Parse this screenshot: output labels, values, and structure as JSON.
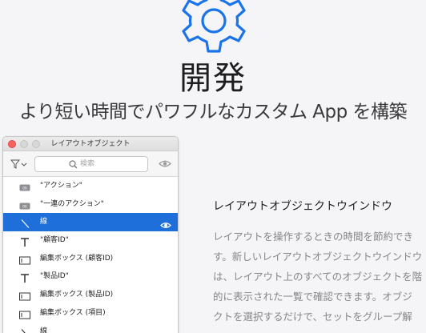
{
  "hero": {
    "icon": "gear-icon",
    "title": "開発",
    "subtitle": "より短い時間でパワフルなカスタム App を構築"
  },
  "colors": {
    "accent": "#1e6fd9",
    "gear": "#1a73e8",
    "close": "#fc605c"
  },
  "panel": {
    "title": "レイアウトオブジェクト",
    "search_placeholder": "検索",
    "rows": [
      {
        "icon": "button-icon",
        "label": "\"アクション\""
      },
      {
        "icon": "button-icon",
        "label": "\"一連のアクション\""
      },
      {
        "icon": "line-icon",
        "label": "線",
        "selected": true
      },
      {
        "icon": "text-icon",
        "label": "\"顧客ID\""
      },
      {
        "icon": "edit-box-icon",
        "label": "編集ボックス (顧客ID)"
      },
      {
        "icon": "text-icon",
        "label": "\"製品ID\""
      },
      {
        "icon": "edit-box-icon",
        "label": "編集ボックス (製品ID)"
      },
      {
        "icon": "edit-box-icon",
        "label": "編集ボックス (項目)"
      },
      {
        "icon": "line-icon",
        "label": "線"
      }
    ]
  },
  "side": {
    "heading": "レイアウトオブジェクトウインドウ",
    "body_lines": [
      "レイアウトを操作するときの時間を節約でき",
      "す。新しいレイアウトオブジェクトウインドウ",
      "は、レイアウト上のすべてのオブジェクトを階",
      "的に表示された一覧で確認できます。オブジ",
      "クトを選択するだけで、セットをグループ解"
    ]
  }
}
